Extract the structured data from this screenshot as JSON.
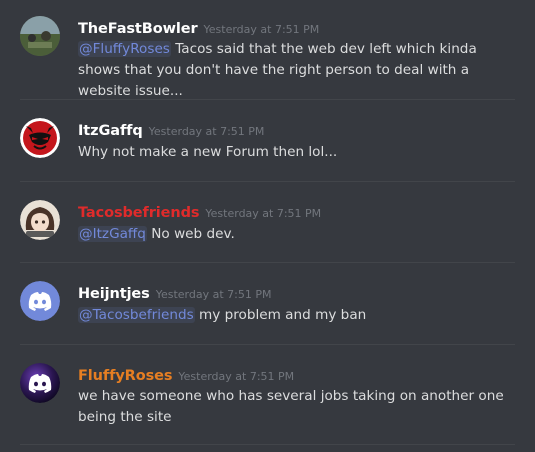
{
  "messages": [
    {
      "author": "TheFastBowler",
      "author_color": "#ffffff",
      "timestamp": "Yesterday at 7:51 PM",
      "mention": "@FluffyRoses",
      "text": " Tacos said that the web dev left which kinda shows that you don't have the right person to deal with a website issue..."
    },
    {
      "author": "ItzGaffq",
      "author_color": "#ffffff",
      "timestamp": "Yesterday at 7:51 PM",
      "mention": "",
      "text": "Why not make a new Forum then lol..."
    },
    {
      "author": "Tacosbefriends",
      "author_color": "#e02b2b",
      "timestamp": "Yesterday at 7:51 PM",
      "mention": "@ItzGaffq",
      "text": " No web dev."
    },
    {
      "author": "Heijntjes",
      "author_color": "#ffffff",
      "timestamp": "Yesterday at 7:51 PM",
      "mention": "@Tacosbefriends",
      "text": " my problem and my ban"
    },
    {
      "author": "FluffyRoses",
      "author_color": "#e67e22",
      "timestamp": "Yesterday at 7:51 PM",
      "mention": "",
      "text": "we have someone who has several jobs taking on another one being the site"
    }
  ],
  "colors": {
    "background": "#36393f",
    "mention": "#7289da",
    "timestamp": "#72767d",
    "discord_blurple": "#7289da"
  },
  "icons": [
    "photo-avatar",
    "devil-avatar",
    "anime-avatar",
    "discord-logo-avatar",
    "discord-logo-purple-avatar"
  ]
}
